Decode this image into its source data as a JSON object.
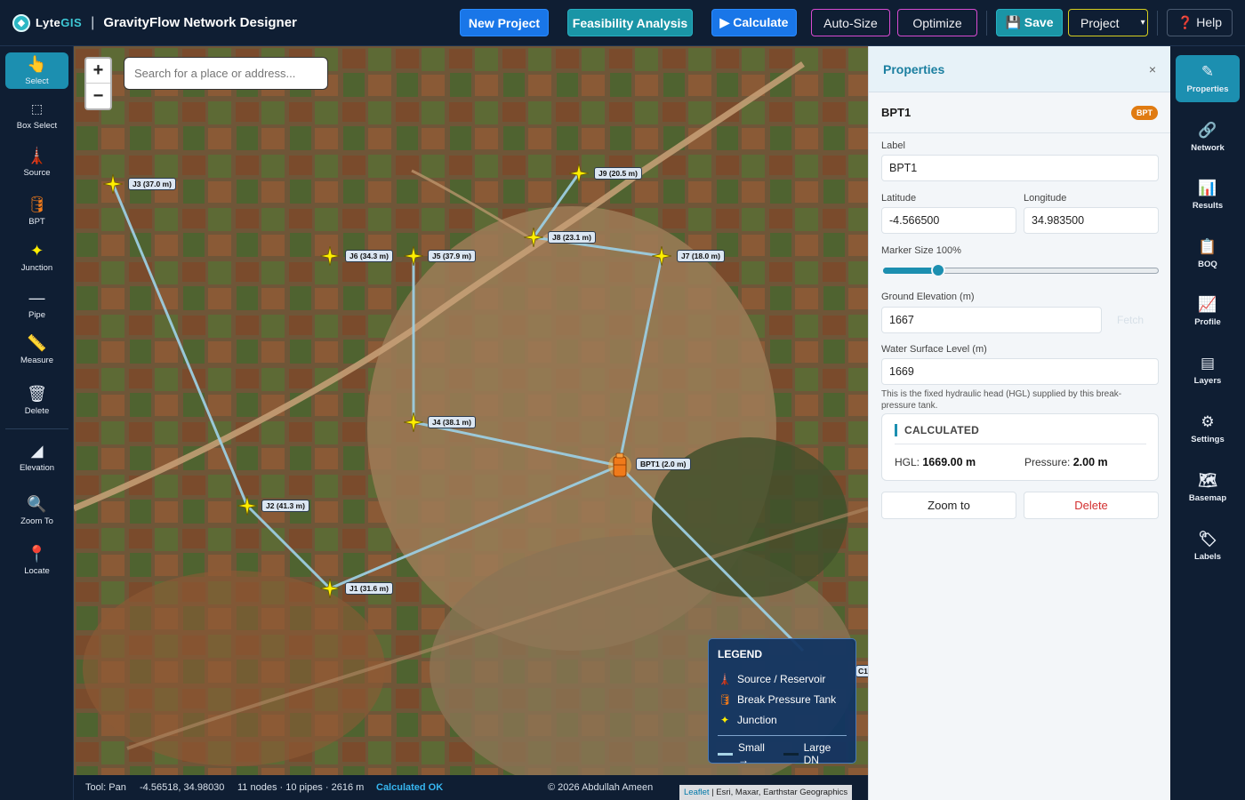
{
  "brand": {
    "logo_prefix": "Lyte",
    "logo_suffix": "GIS",
    "separator": "|",
    "app_title": "GravityFlow Network Designer"
  },
  "toolbar": {
    "new_project": "New Project",
    "feasibility": "Feasibility Analysis",
    "calculate": "▶ Calculate",
    "auto_size": "Auto-Size",
    "optimize": "Optimize",
    "save": "💾 Save",
    "project": "Project",
    "project_caret": "▾",
    "help": "❓ Help"
  },
  "left_tools": [
    {
      "label": "Select",
      "icon": "pointer-hand-icon",
      "glyph": "👆",
      "active": true
    },
    {
      "label": "Box Select",
      "icon": "box-select-icon",
      "glyph": "⬚"
    },
    {
      "label": "Source",
      "icon": "water-tower-icon",
      "glyph": "🗼"
    },
    {
      "label": "BPT",
      "icon": "tank-icon",
      "glyph": "🛢"
    },
    {
      "label": "Junction",
      "icon": "junction-star-icon",
      "glyph": "✦"
    },
    {
      "label": "Pipe",
      "icon": "pipe-line-icon",
      "glyph": "—"
    },
    {
      "label": "Measure",
      "icon": "ruler-icon",
      "glyph": "📏"
    },
    {
      "label": "Delete",
      "icon": "trash-icon",
      "glyph": "🗑"
    },
    {
      "label": "Elevation",
      "icon": "elevation-icon",
      "glyph": "◢"
    },
    {
      "label": "Zoom To",
      "icon": "magnifier-icon",
      "glyph": "🔍"
    },
    {
      "label": "Locate",
      "icon": "map-pin-icon",
      "glyph": "📍"
    }
  ],
  "map": {
    "zoom_in": "+",
    "zoom_out": "−",
    "search_placeholder": "Search for a place or address...",
    "nodes": [
      {
        "id": "J3",
        "label": "J3 (37.0 m)",
        "type": "junction"
      },
      {
        "id": "J9",
        "label": "J9 (20.5 m)",
        "type": "junction"
      },
      {
        "id": "J8",
        "label": "J8 (23.1 m)",
        "type": "junction"
      },
      {
        "id": "J6",
        "label": "J6 (34.3 m)",
        "type": "junction"
      },
      {
        "id": "J5",
        "label": "J5 (37.9 m)",
        "type": "junction"
      },
      {
        "id": "J7",
        "label": "J7 (18.0 m)",
        "type": "junction"
      },
      {
        "id": "J4",
        "label": "J4 (38.1 m)",
        "type": "junction"
      },
      {
        "id": "BPT1",
        "label": "BPT1 (2.0 m)",
        "type": "bpt"
      },
      {
        "id": "J2",
        "label": "J2 (41.3 m)",
        "type": "junction"
      },
      {
        "id": "J1",
        "label": "J1 (31.6 m)",
        "type": "junction"
      }
    ],
    "offscreen_label_fragment": "C1"
  },
  "legend": {
    "title": "LEGEND",
    "items": [
      {
        "label": "Source / Reservoir",
        "icon": "water-tower-icon",
        "glyph": "🗼"
      },
      {
        "label": "Break Pressure Tank",
        "icon": "tank-icon",
        "glyph": "🛢"
      },
      {
        "label": "Junction",
        "icon": "junction-star-icon",
        "glyph": "✦"
      }
    ],
    "small_label": "Small →",
    "large_label": "Large DN"
  },
  "status": {
    "tool": "Tool: Pan",
    "coords": "-4.56518, 34.98030",
    "summary": "11 nodes · 10 pipes · 2616 m",
    "calc_status": "Calculated OK",
    "copyright": "© 2026 Abdullah Ameen",
    "attribution_leaflet": "Leaflet",
    "attribution_rest": " | Esri, Maxar, Earthstar Geographics"
  },
  "properties": {
    "title": "Properties",
    "close": "×",
    "object_name": "BPT1",
    "badge": "BPT",
    "label_field": {
      "label": "Label",
      "value": "BPT1"
    },
    "latitude": {
      "label": "Latitude",
      "value": "-4.566500"
    },
    "longitude": {
      "label": "Longitude",
      "value": "34.983500"
    },
    "marker_size": {
      "label": "Marker Size 100%",
      "value": 0.2
    },
    "ground_elevation": {
      "label": "Ground Elevation (m)",
      "value": "1667",
      "fetch": "Fetch"
    },
    "water_surface": {
      "label": "Water Surface Level (m)",
      "value": "1669"
    },
    "help_text": "This is the fixed hydraulic head (HGL) supplied by this break-pressure tank.",
    "calculated": {
      "title": "CALCULATED",
      "hgl_label": "HGL:",
      "hgl_value": "1669.00 m",
      "pressure_label": "Pressure:",
      "pressure_value": "2.00 m"
    },
    "zoom_to": "Zoom to",
    "delete": "Delete"
  },
  "right_rail": [
    {
      "label": "Properties",
      "icon": "pencil-icon",
      "glyph": "✎",
      "active": true
    },
    {
      "label": "Network",
      "icon": "link-icon",
      "glyph": "🔗"
    },
    {
      "label": "Results",
      "icon": "bar-chart-icon",
      "glyph": "📊"
    },
    {
      "label": "BOQ",
      "icon": "clipboard-icon",
      "glyph": "📋"
    },
    {
      "label": "Profile",
      "icon": "line-chart-icon",
      "glyph": "📈"
    },
    {
      "label": "Layers",
      "icon": "layers-icon",
      "glyph": "▤"
    },
    {
      "label": "Settings",
      "icon": "gear-icon",
      "glyph": "⚙"
    },
    {
      "label": "Basemap",
      "icon": "basemap-stack-icon",
      "glyph": "🗺"
    },
    {
      "label": "Labels",
      "icon": "tag-icon",
      "glyph": "🏷"
    }
  ],
  "colors": {
    "accent": "#1c8fb0",
    "primary_blue": "#1976e8",
    "junction": "#ffee00",
    "bpt": "#f07a1a",
    "pipe": "#9ccde0",
    "danger": "#d32f2f"
  }
}
